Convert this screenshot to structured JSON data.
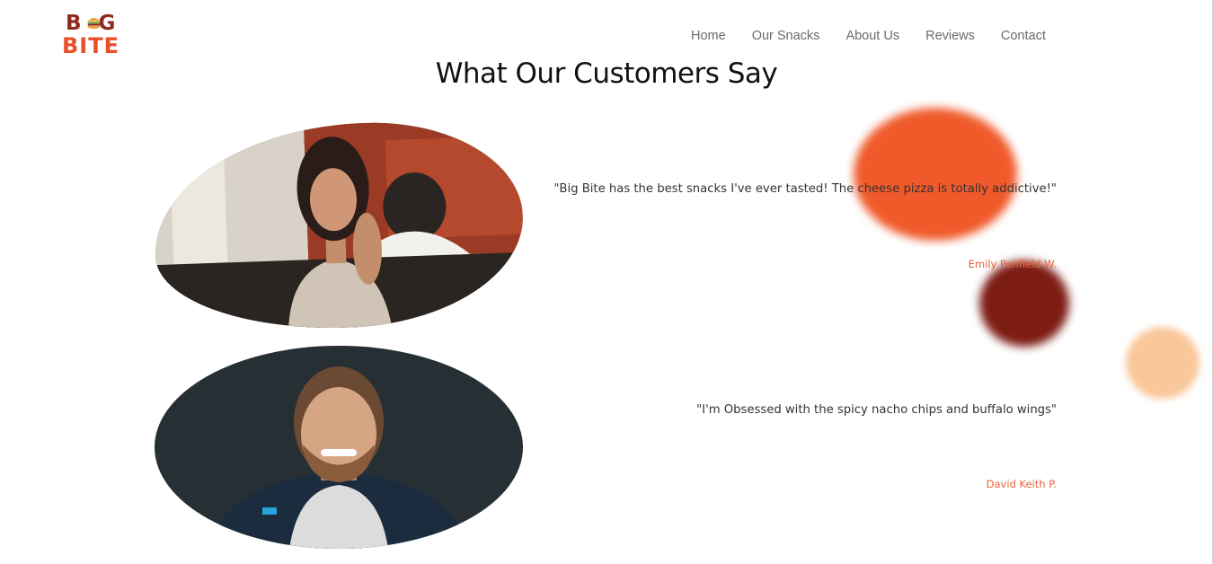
{
  "brand": {
    "line1": "BIG",
    "line2": "BITE"
  },
  "nav": {
    "items": [
      {
        "label": "Home"
      },
      {
        "label": "Our Snacks"
      },
      {
        "label": "About Us"
      },
      {
        "label": "Reviews"
      },
      {
        "label": "Contact"
      }
    ]
  },
  "reviews": {
    "title": "What Our Customers Say",
    "items": [
      {
        "quote": "\"Big Bite has the best snacks I've ever tasted! The cheese pizza is totally addictive!\"",
        "author": "Emily Penfield W."
      },
      {
        "quote": "\"I'm Obsessed with the spicy nacho chips and buffalo wings\"",
        "author": "David Keith P."
      }
    ]
  },
  "colors": {
    "accent": "#e8633a",
    "blob_orange": "#f05a2b",
    "blob_maroon": "#7d1c14",
    "blob_peach": "#f9c79a"
  }
}
